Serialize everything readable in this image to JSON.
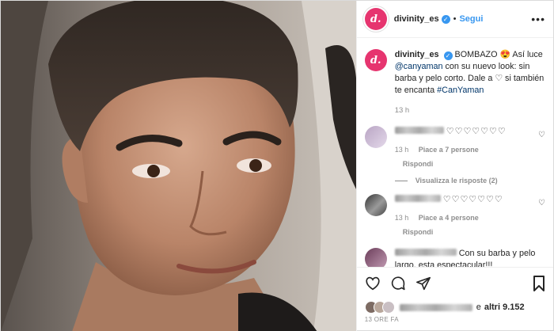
{
  "header": {
    "username": "divinity_es",
    "separator": "•",
    "follow_label": "Segui",
    "avatar_letter": "d."
  },
  "caption": {
    "username": "divinity_es",
    "text_1": "BOMBAZO",
    "emoji": "😍",
    "text_2": "Así luce",
    "mention": "@canyaman",
    "text_3": "con su nuevo look: sin barba y pelo corto. Dale a",
    "text_4": "si también te encanta",
    "hashtag": "#CanYaman",
    "time": "13 h"
  },
  "comments": [
    {
      "text": "♡♡♡♡♡♡♡",
      "time": "13 h",
      "likes": "Piace a 7 persone",
      "reply": "Rispondi",
      "view_replies": "Visualizza le risposte (2)"
    },
    {
      "text": "♡♡♡♡♡♡♡",
      "time": "13 h",
      "likes": "Piace a 4 persone",
      "reply": "Rispondi"
    },
    {
      "text": "Con su barba y pelo largo, esta espectacular!!!"
    }
  ],
  "likes_summary": {
    "prefix": "e",
    "count_text": "altri 9.152"
  },
  "timestamp": "13 ORE FA",
  "colors": {
    "brand": "#e6356f",
    "link": "#003569",
    "follow": "#3897f0",
    "muted": "#8e8e8e"
  },
  "icons": {
    "like": "heart-outline-icon",
    "comment": "comment-bubble-icon",
    "share": "paper-plane-icon",
    "save": "bookmark-icon",
    "more": "ellipsis-icon"
  }
}
